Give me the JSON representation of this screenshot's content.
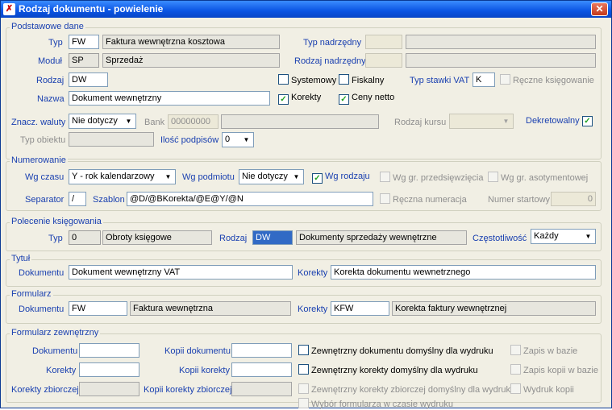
{
  "window": {
    "title": "Rodzaj dokumentu - powielenie",
    "close": "✕"
  },
  "podstawowe": {
    "title": "Podstawowe dane",
    "typ_label": "Typ",
    "typ_code": "FW",
    "typ_name": "Faktura wewnętrzna kosztowa",
    "typ_nadrzedny_label": "Typ nadrzędny",
    "typ_nadrzedny_code": "",
    "typ_nadrzedny_name": "",
    "modul_label": "Moduł",
    "modul_code": "SP",
    "modul_name": "Sprzedaż",
    "rodzaj_nadrzedny_label": "Rodzaj nadrzędny",
    "rodzaj_nadrzedny_code": "",
    "rodzaj_nadrzedny_name": "",
    "rodzaj_label": "Rodzaj",
    "rodzaj_value": "DW",
    "systemowy": "Systemowy",
    "fiskalny": "Fiskalny",
    "typ_stawki_label": "Typ stawki VAT",
    "typ_stawki_value": "K",
    "reczne_ksiegowanie": "Ręczne księgowanie",
    "nazwa_label": "Nazwa",
    "nazwa_value": "Dokument wewnętrzny",
    "korekty": "Korekty",
    "ceny_netto": "Ceny netto",
    "znacz_waluty_label": "Znacz. waluty",
    "znacz_waluty_value": "Nie dotyczy",
    "bank_label": "Bank",
    "bank_code": "00000000",
    "bank_name": "",
    "rodzaj_kursu_label": "Rodzaj kursu",
    "rodzaj_kursu_value": "",
    "dekretowalny": "Dekretowalny",
    "typ_obiektu_label": "Typ obiektu",
    "typ_obiektu_value": "",
    "ilosc_podpisow_label": "Ilość podpisów",
    "ilosc_podpisow_value": "0"
  },
  "numerowanie": {
    "title": "Numerowanie",
    "wg_czasu_label": "Wg czasu",
    "wg_czasu_value": "Y - rok kalendarzowy",
    "wg_podmiotu_label": "Wg podmiotu",
    "wg_podmiotu_value": "Nie dotyczy",
    "wg_rodzaju": "Wg rodzaju",
    "wg_gr_przedsiewziecia": "Wg gr. przedsięwzięcia",
    "wg_gr_asortymentowej": "Wg gr. asotymentowej",
    "separator_label": "Separator",
    "separator_value": "/",
    "szablon_label": "Szablon",
    "szablon_value": "@D/@BKorekta/@E@Y/@N",
    "reczna_numeracja": "Ręczna numeracja",
    "numer_startowy_label": "Numer startowy",
    "numer_startowy_value": "0"
  },
  "polecenie": {
    "title": "Polecenie księgowania",
    "typ_label": "Typ",
    "typ_code": "0",
    "typ_name": "Obroty księgowe",
    "rodzaj_label": "Rodzaj",
    "rodzaj_code": "DW",
    "rodzaj_name": "Dokumenty sprzedaży wewnętrzne",
    "czestotliwosc_label": "Częstotliwość",
    "czestotliwosc_value": "Każdy"
  },
  "tytul": {
    "title": "Tytuł",
    "dokumentu_label": "Dokumentu",
    "dokumentu_value": "Dokument wewnętrzny VAT",
    "korekty_label": "Korekty",
    "korekty_value": "Korekta dokumentu wewnetrznego"
  },
  "formularz": {
    "title": "Formularz",
    "dokumentu_label": "Dokumentu",
    "dokumentu_code": "FW",
    "dokumentu_name": "Faktura wewnętrzna",
    "korekty_label": "Korekty",
    "korekty_code": "KFW",
    "korekty_name": "Korekta faktury wewnętrznej"
  },
  "zewnetrzny": {
    "title": "Formularz zewnętrzny",
    "dokumentu_label": "Dokumentu",
    "kopii_dokumentu_label": "Kopii dokumentu",
    "korekty_label": "Korekty",
    "kopii_korekty_label": "Kopii korekty",
    "korekty_zbiorczej_label": "Korekty zbiorczej",
    "kopii_korekty_zbiorczej_label": "Kopii korekty zbiorczej",
    "chk_dok_domyslny": "Zewnętrzny dokumentu domyślny dla wydruku",
    "chk_kor_domyslny": "Zewnętrzny korekty domyślny dla wydruku",
    "chk_kor_zb_domyslny": "Zewnętrzny korekty zbiorczej domyślny dla wydruku",
    "chk_wybor": "Wybór formularza w czasie wydruku",
    "zapis_w_bazie": "Zapis w bazie",
    "zapis_kopii": "Zapis kopii w bazie",
    "wydruk_kopii": "Wydruk kopii"
  }
}
